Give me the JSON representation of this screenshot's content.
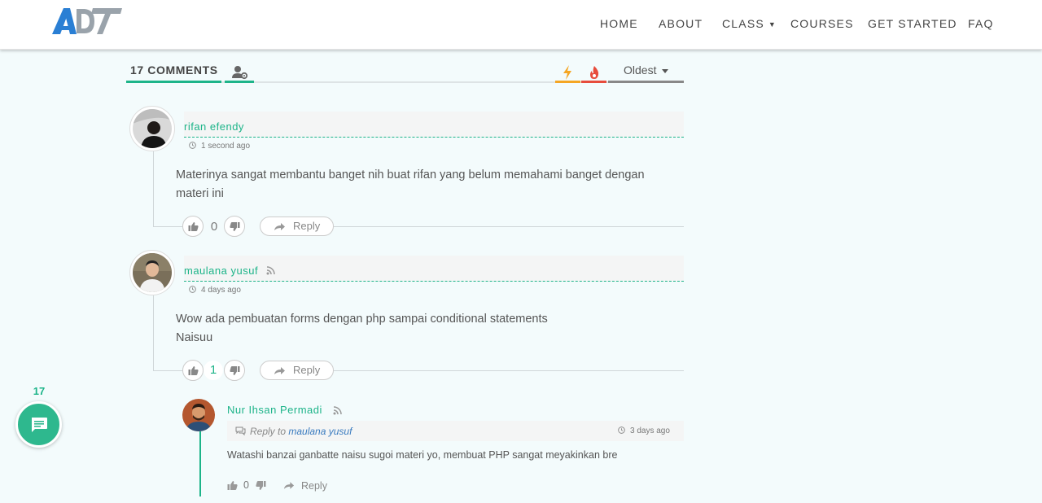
{
  "nav": {
    "logo_alt": "ADT",
    "items": [
      "HOME",
      "ABOUT",
      "CLASS",
      "COURSES",
      "GET STARTED",
      "FAQ"
    ]
  },
  "comments_header": {
    "count_label": "17 COMMENTS",
    "sort_label": "Oldest",
    "icons": [
      "users-settings-icon",
      "bolt-icon",
      "fire-icon"
    ],
    "colors": {
      "accent": "#1db489",
      "bolt": "#f5a623",
      "fire": "#e74c3c"
    }
  },
  "comments": [
    {
      "author": "rifan efendy",
      "time": "1 second ago",
      "text": "Materinya sangat membantu banget nih buat rifan yang belum memahami banget dengan materi ini",
      "votes": "0",
      "reply_label": "Reply"
    },
    {
      "author": "maulana yusuf",
      "time": "4 days ago",
      "text_lines": [
        "Wow ada pembuatan forms dengan php sampai conditional statements",
        "Naisuu"
      ],
      "votes": "1",
      "reply_label": "Reply"
    }
  ],
  "reply": {
    "author": "Nur Ihsan Permadi",
    "reply_to_prefix": "Reply to",
    "reply_to_name": "maulana yusuf",
    "time": "3 days ago",
    "text": "Watashi banzai ganbatte naisu sugoi materi yo, membuat PHP sangat meyakinkan bre",
    "votes": "0",
    "reply_label": "Reply"
  },
  "floating": {
    "count": "17"
  }
}
